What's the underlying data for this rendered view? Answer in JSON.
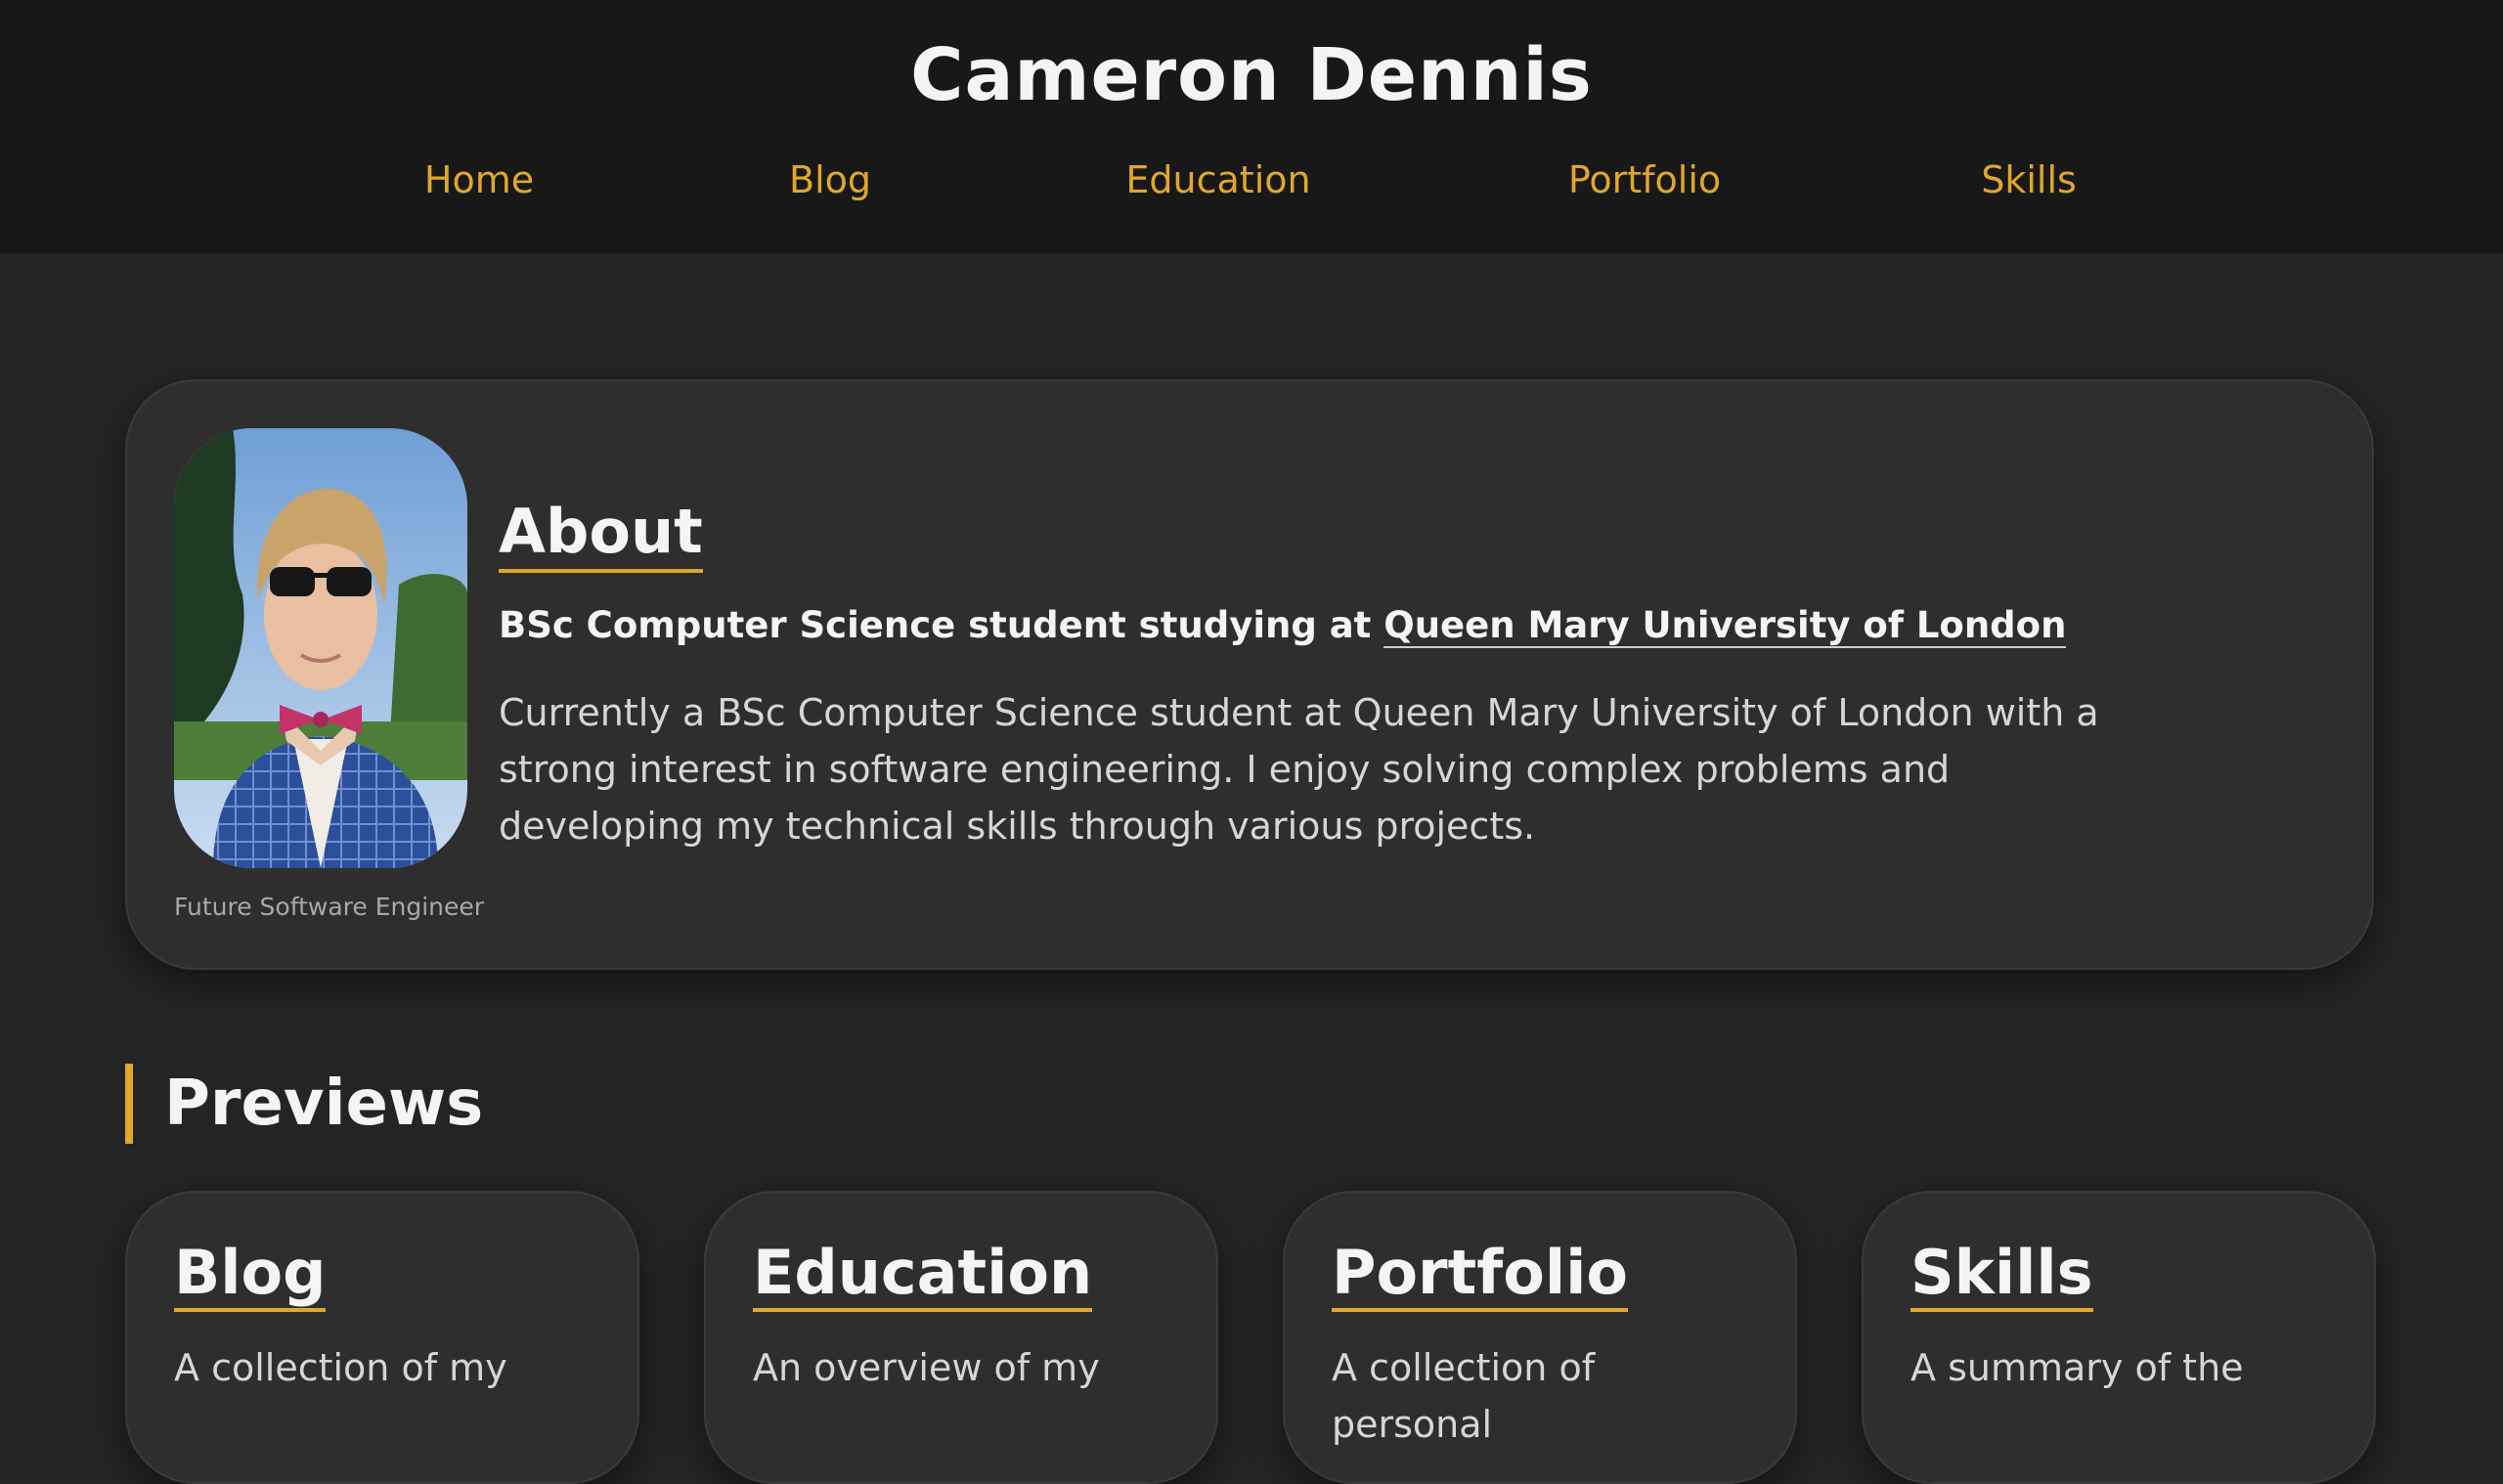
{
  "header": {
    "title": "Cameron Dennis",
    "nav": [
      {
        "label": "Home"
      },
      {
        "label": "Blog"
      },
      {
        "label": "Education"
      },
      {
        "label": "Portfolio"
      },
      {
        "label": "Skills"
      }
    ]
  },
  "about": {
    "photo_caption": "Future Software Engineer",
    "heading": "About",
    "subheading_prefix": "BSc Computer Science student studying at ",
    "subheading_link": "Queen Mary University of London",
    "body": "Currently a BSc Computer Science student at Queen Mary University of London with a strong interest in software engineering. I enjoy solving complex problems and developing my technical skills through various projects."
  },
  "previews": {
    "heading": "Previews",
    "cards": [
      {
        "title": "Blog",
        "text": "A collection of my"
      },
      {
        "title": "Education",
        "text": "An overview of my"
      },
      {
        "title": "Portfolio",
        "text": "A collection of personal"
      },
      {
        "title": "Skills",
        "text": "A summary of the"
      }
    ]
  },
  "colors": {
    "accent": "#e0a72a",
    "header_bg": "#181818",
    "page_bg": "#242424",
    "card_bg": "#2e2e2e"
  }
}
